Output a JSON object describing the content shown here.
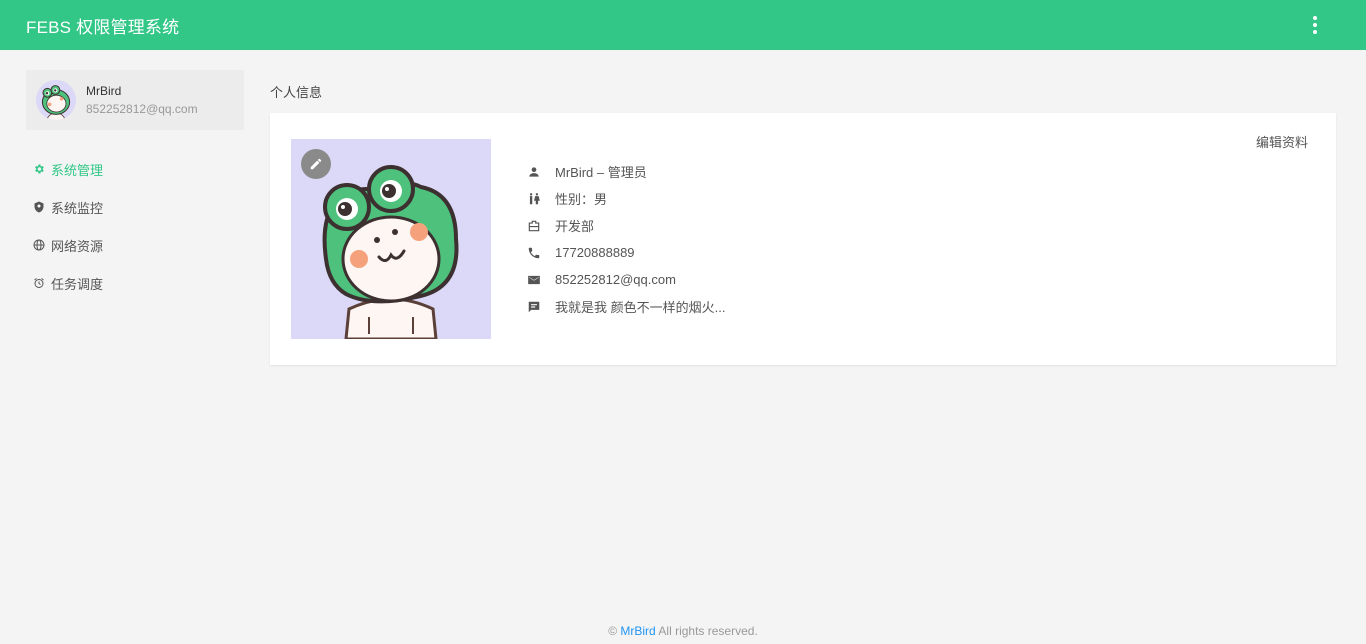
{
  "header": {
    "app_title": "FEBS 权限管理系统",
    "more_icon": "more-vert-icon",
    "color": "#32c787"
  },
  "user": {
    "name": "MrBird",
    "email": "852252812@qq.com"
  },
  "sidebar": {
    "items": [
      {
        "label": "系统管理",
        "icon": "gear-icon",
        "active": true
      },
      {
        "label": "系统监控",
        "icon": "shield-icon",
        "active": false
      },
      {
        "label": "网络资源",
        "icon": "globe-icon",
        "active": false
      },
      {
        "label": "任务调度",
        "icon": "alarm-icon",
        "active": false
      }
    ]
  },
  "main": {
    "section_title": "个人信息",
    "edit_profile_label": "编辑资料",
    "info": {
      "name_role": "MrBird – 管理员",
      "gender": "性别：男",
      "department": "开发部",
      "phone": "17720888889",
      "email": "852252812@qq.com",
      "description": "我就是我 颜色不一样的烟火..."
    }
  },
  "footer": {
    "copyright_symbol": "©",
    "link": "MrBird",
    "text": "All rights reserved."
  }
}
